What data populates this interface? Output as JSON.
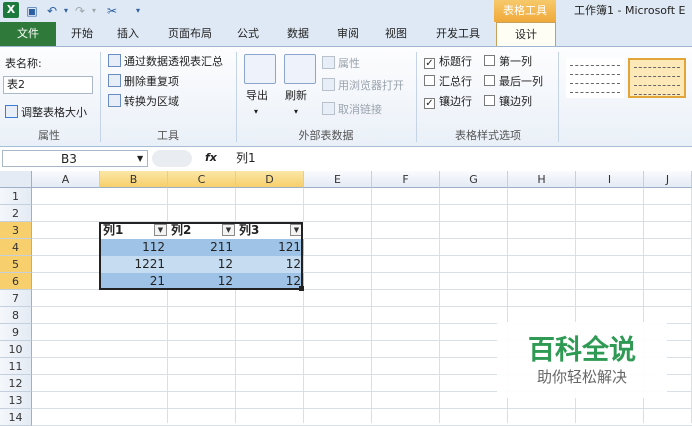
{
  "titlebar": {
    "quick_access": {
      "undo": "↶",
      "redo": "↷"
    },
    "context_tab": "表格工具",
    "window_title": "工作簿1 - Microsoft E"
  },
  "tabs": [
    "文件",
    "开始",
    "插入",
    "页面布局",
    "公式",
    "数据",
    "审阅",
    "视图",
    "开发工具",
    "设计"
  ],
  "ribbon": {
    "properties": {
      "table_name_label": "表名称:",
      "table_name_value": "表2",
      "resize": "调整表格大小",
      "group": "属性"
    },
    "tools": {
      "pivot": "通过数据透视表汇总",
      "dedupe": "删除重复项",
      "to_range": "转换为区域",
      "group": "工具"
    },
    "external": {
      "export": "导出",
      "refresh": "刷新",
      "props": "属性",
      "open_browser": "用浏览器打开",
      "unlink": "取消链接",
      "group": "外部表数据"
    },
    "style_options": {
      "header_row": "标题行",
      "total_row": "汇总行",
      "banded_rows": "镶边行",
      "first_col": "第一列",
      "last_col": "最后一列",
      "banded_cols": "镶边列",
      "group": "表格样式选项"
    },
    "checks": {
      "header_row": true,
      "total_row": false,
      "banded_rows": true,
      "first_col": false,
      "last_col": false,
      "banded_cols": false
    }
  },
  "formula_bar": {
    "name_box": "B3",
    "fx": "fx",
    "content": "列1"
  },
  "grid": {
    "columns": [
      "A",
      "B",
      "C",
      "D",
      "E",
      "F",
      "G",
      "H",
      "I",
      "J"
    ],
    "rows": [
      "1",
      "2",
      "3",
      "4",
      "5",
      "6",
      "7",
      "8",
      "9",
      "10",
      "11",
      "12",
      "13",
      "14"
    ],
    "table": {
      "headers": [
        "列1",
        "列2",
        "列3"
      ],
      "rows": [
        [
          "112",
          "211",
          "121"
        ],
        [
          "1221",
          "12",
          "12"
        ],
        [
          "21",
          "12",
          "12"
        ]
      ]
    }
  },
  "watermark": {
    "title": "百科全说",
    "subtitle": "助你轻松解决"
  },
  "colors": {
    "file_tab": "#2f7a3b",
    "context_tab": "#f0a93a",
    "band_dark": "#9ec3e6",
    "band_light": "#c5dcf1",
    "selected_header": "#f7cf6c",
    "watermark_title": "#2f9a53"
  }
}
